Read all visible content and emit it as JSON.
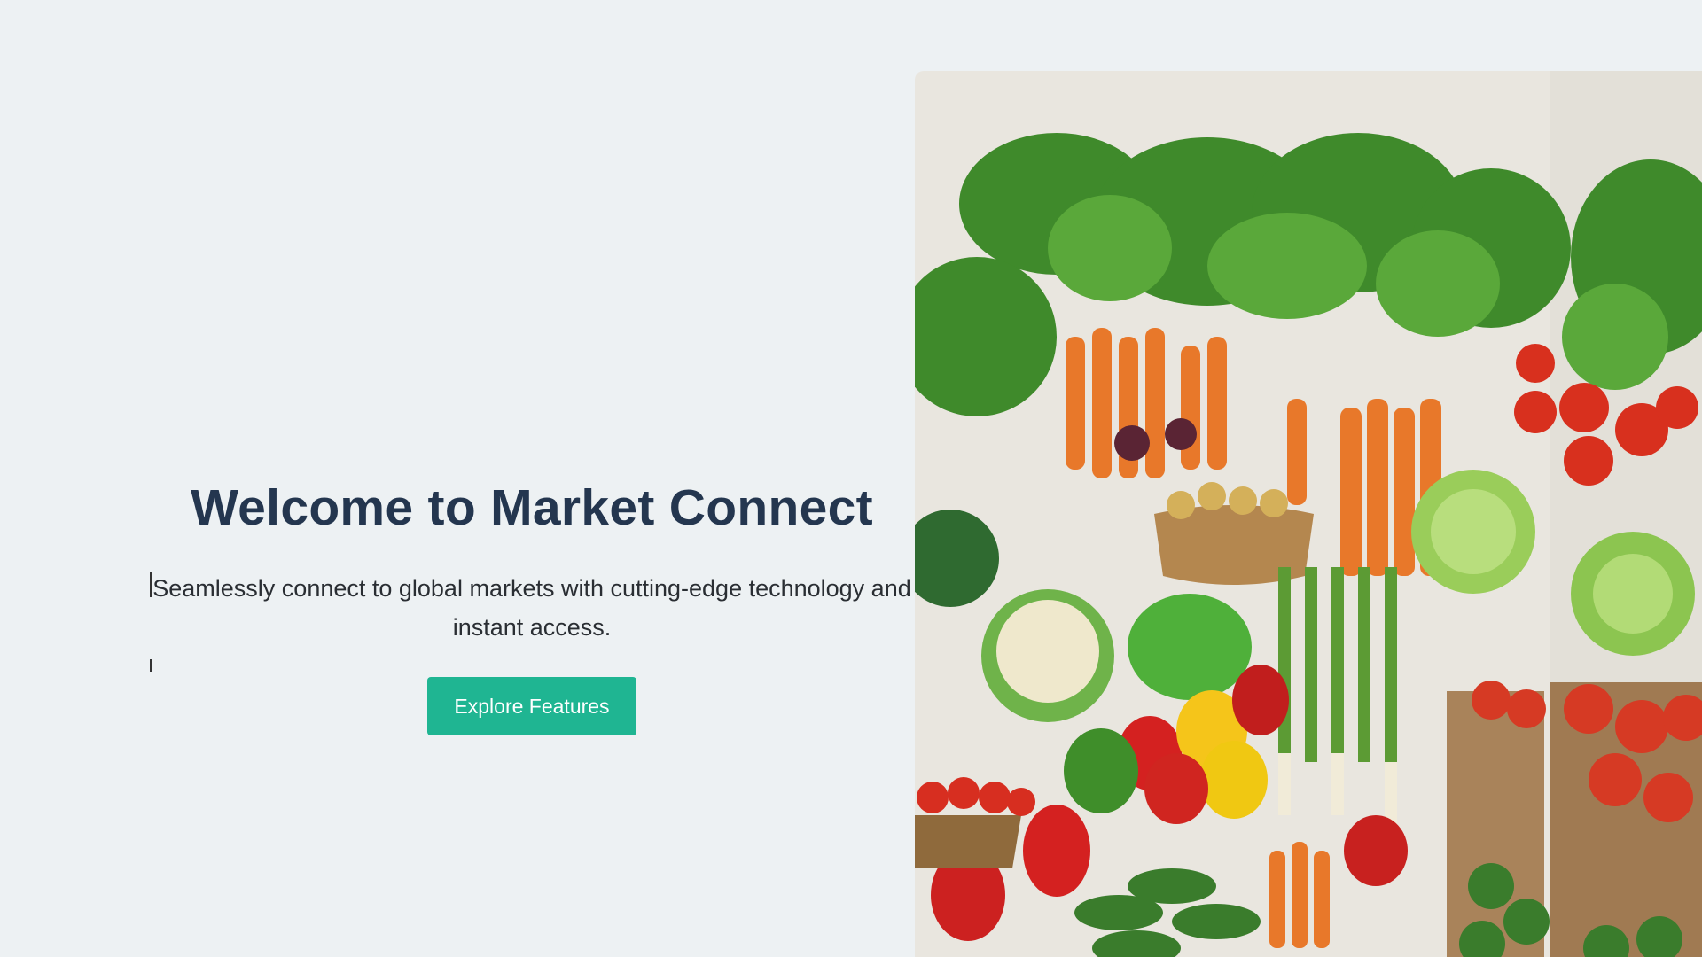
{
  "hero": {
    "title": "Welcome to Market Connect",
    "subtitle": "Seamlessly connect to global markets with cutting-edge technology and instant access.",
    "cta_label": "Explore Features"
  },
  "colors": {
    "background": "#edf1f3",
    "title": "#24364f",
    "accent": "#1fb592"
  }
}
